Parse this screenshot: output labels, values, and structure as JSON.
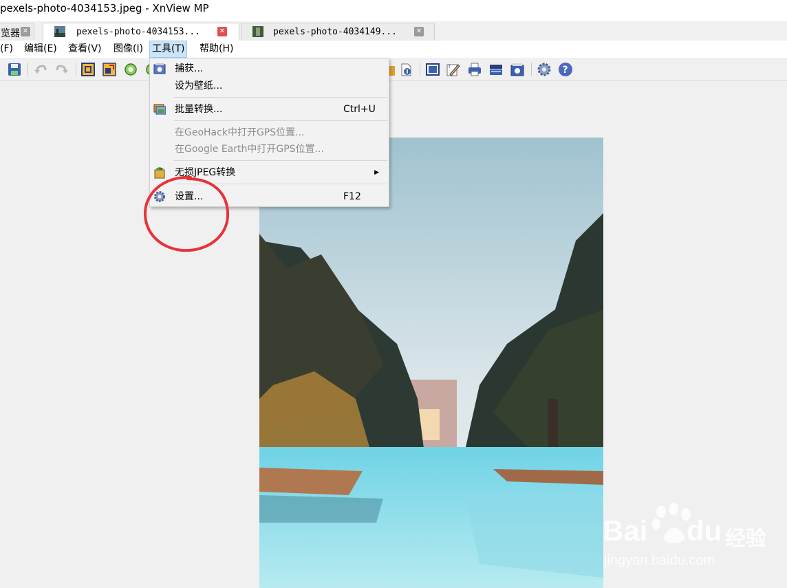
{
  "window": {
    "title": "pexels-photo-4034153.jpeg - XnView MP"
  },
  "tabs": [
    {
      "label": "览器"
    },
    {
      "label": "pexels-photo-4034153..."
    },
    {
      "label": "pexels-photo-4034149..."
    }
  ],
  "menubar": [
    {
      "label": "(F)"
    },
    {
      "label": "编辑(E)"
    },
    {
      "label": "查看(V)"
    },
    {
      "label": "图像(I)"
    },
    {
      "label": "工具(T)"
    },
    {
      "label": "帮助(H)"
    }
  ],
  "tools_menu": {
    "items": [
      {
        "label": "捕获...",
        "shortcut": "",
        "icon": "camera-icon"
      },
      {
        "label": "设为壁纸...",
        "shortcut": ""
      },
      {
        "label": "批量转换...",
        "shortcut": "Ctrl+U",
        "icon": "batch-convert-icon"
      },
      {
        "label": "在GeoHack中打开GPS位置...",
        "shortcut": ""
      },
      {
        "label": "在Google Earth中打开GPS位置...",
        "shortcut": ""
      },
      {
        "label": "无损JPEG转换",
        "shortcut": "",
        "icon": "jpeg-transform-icon"
      },
      {
        "label": "设置...",
        "shortcut": "F12",
        "icon": "gear-icon"
      }
    ]
  },
  "watermark": {
    "line1": "Bai",
    "line2": "du",
    "line3": "经验",
    "line4": "jingyan.baidu.com"
  },
  "colors": {
    "annotation": "#e8323a",
    "menu_open_bg": "#cce4f7",
    "disabled_text": "#8c8c8c"
  }
}
